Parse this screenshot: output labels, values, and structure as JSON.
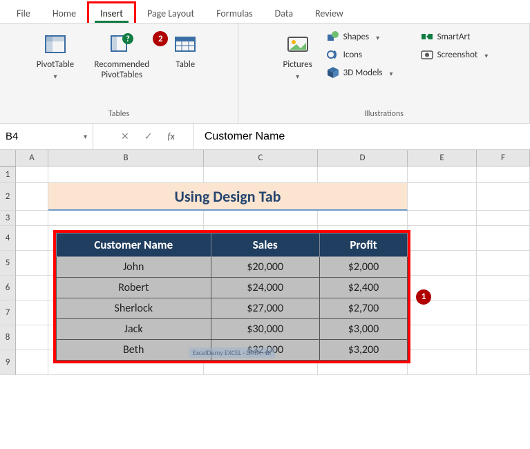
{
  "tabs": {
    "file": "File",
    "home": "Home",
    "insert": "Insert",
    "page_layout": "Page Layout",
    "formulas": "Formulas",
    "data": "Data",
    "review": "Review"
  },
  "ribbon": {
    "tables": {
      "label": "Tables",
      "pivottable": "PivotTable",
      "recommended_line1": "Recommended",
      "recommended_line2": "PivotTables",
      "table": "Table"
    },
    "illustrations": {
      "label": "Illustrations",
      "pictures": "Pictures",
      "shapes": "Shapes",
      "icons": "Icons",
      "models": "3D Models",
      "smartart": "SmartArt",
      "screenshot": "Screenshot"
    }
  },
  "namebox": {
    "value": "B4"
  },
  "formula": {
    "value": "Customer Name"
  },
  "columns": [
    "",
    "A",
    "B",
    "C",
    "D",
    "E",
    "F"
  ],
  "rows": [
    "1",
    "2",
    "3",
    "4",
    "5",
    "6",
    "7",
    "8",
    "9"
  ],
  "title": "Using Design Tab",
  "chart_data": {
    "type": "table",
    "columns": [
      "Customer Name",
      "Sales",
      "Profit"
    ],
    "rows": [
      {
        "Customer Name": "John",
        "Sales": "$20,000",
        "Profit": "$2,000"
      },
      {
        "Customer Name": "Robert",
        "Sales": "$24,000",
        "Profit": "$2,400"
      },
      {
        "Customer Name": "Sherlock",
        "Sales": "$27,000",
        "Profit": "$2,700"
      },
      {
        "Customer Name": "Jack",
        "Sales": "$30,000",
        "Profit": "$3,000"
      },
      {
        "Customer Name": "Beth",
        "Sales": "$32,000",
        "Profit": "$3,200"
      }
    ]
  },
  "callouts": {
    "one": "1",
    "two": "2"
  },
  "watermark": "ExcelDemy EXCEL · DATA · BI"
}
